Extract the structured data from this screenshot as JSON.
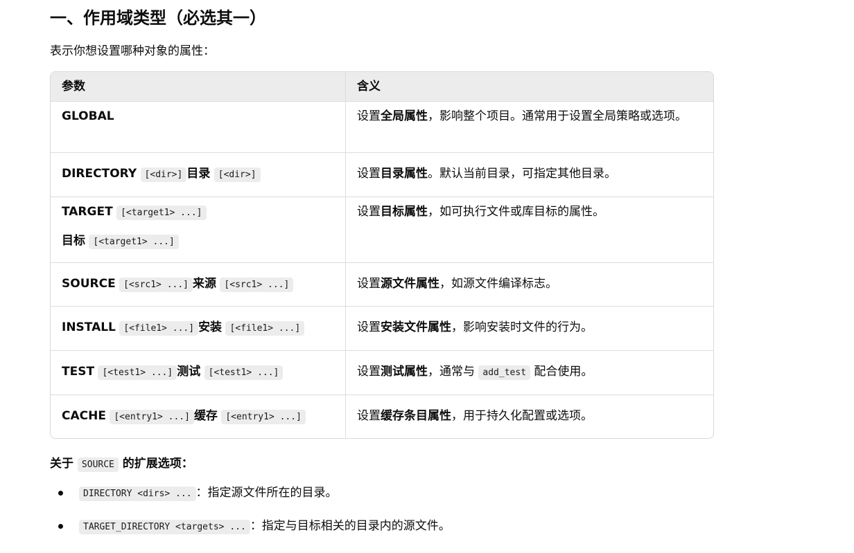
{
  "heading": "一、作用域类型（必选其一）",
  "intro": "表示你想设置哪种对象的属性：",
  "table": {
    "headers": [
      "参数",
      "含义"
    ],
    "rows": [
      {
        "param": "GLOBAL",
        "desc_pre": "设置",
        "desc_bold": "全局属性",
        "desc_post": "，影响整个项目。通常用于设置全局策略或选项。"
      },
      {
        "param": "DIRECTORY",
        "code1": "[<dir>]",
        "label": "目录",
        "code2": "[<dir>]",
        "desc_pre": "设置",
        "desc_bold": "目录属性",
        "desc_post": "。默认当前目录，可指定其他目录。"
      },
      {
        "param": "TARGET",
        "code1": "[<target1> ...]",
        "label": "目标",
        "code2": "[<target1> ...]",
        "desc_pre": "设置",
        "desc_bold": "目标属性",
        "desc_post": "，如可执行文件或库目标的属性。"
      },
      {
        "param": "SOURCE",
        "code1": "[<src1> ...]",
        "label": "来源",
        "code2": "[<src1> ...]",
        "desc_pre": "设置",
        "desc_bold": "源文件属性",
        "desc_post": "，如源文件编译标志。"
      },
      {
        "param": "INSTALL",
        "code1": "[<file1> ...]",
        "label": "安装",
        "code2": "[<file1> ...]",
        "desc_pre": "设置",
        "desc_bold": "安装文件属性",
        "desc_post": "，影响安装时文件的行为。"
      },
      {
        "param": "TEST",
        "code1": "[<test1> ...]",
        "label": "测试",
        "code2": "[<test1> ...]",
        "desc_pre": "设置",
        "desc_bold": "测试属性",
        "desc_mid": "，通常与 ",
        "desc_code": "add_test",
        "desc_post": " 配合使用。"
      },
      {
        "param": "CACHE",
        "code1": "[<entry1> ...]",
        "label": "缓存",
        "code2": "[<entry1> ...]",
        "desc_pre": "设置",
        "desc_bold": "缓存条目属性",
        "desc_post": "，用于持久化配置或选项。"
      }
    ]
  },
  "subhead": {
    "pre": "关于 ",
    "code": "SOURCE",
    "post": " 的扩展选项："
  },
  "bullets": [
    {
      "code": "DIRECTORY <dirs> ...",
      "text": "：指定源文件所在的目录。"
    },
    {
      "code": "TARGET_DIRECTORY <targets> ...",
      "text": "：指定与目标相关的目录内的源文件。"
    }
  ]
}
